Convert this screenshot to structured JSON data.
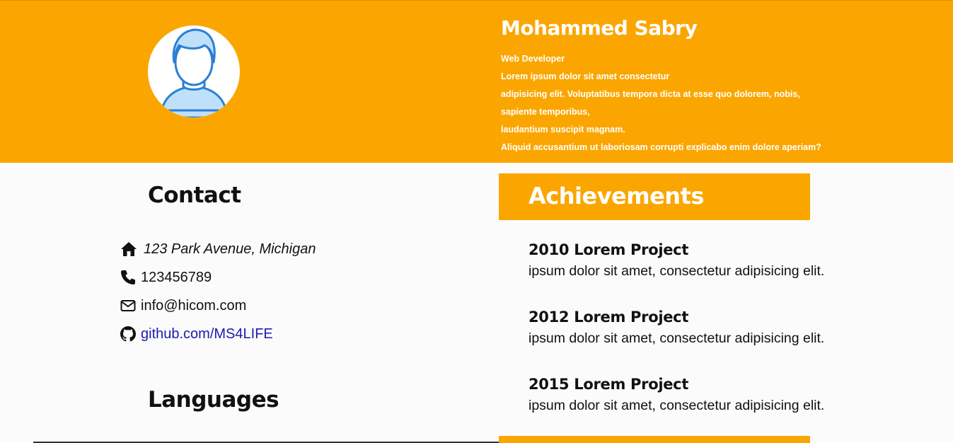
{
  "header": {
    "name": "Mohammed Sabry",
    "bio_lines": [
      "Web Developer",
      "Lorem ipsum dolor sit amet consectetur",
      "adipisicing elit. Voluptatibus tempora dicta at esse quo dolorem, nobis,",
      "sapiente temporibus,",
      "laudantium suscipit magnam.",
      "Aliquid accusantium ut laboriosam corrupti explicabo enim dolore aperiam?"
    ],
    "avatar_icon": "user-avatar-icon"
  },
  "contact": {
    "title": "Contact",
    "address": "123 Park Avenue, Michigan",
    "phone": "123456789",
    "email": "info@hicom.com",
    "github": "github.com/MS4LIFE",
    "icons": [
      "home-icon",
      "phone-icon",
      "envelope-icon",
      "github-icon"
    ]
  },
  "languages": {
    "title": "Languages"
  },
  "achievements": {
    "title": "Achievements",
    "items": [
      {
        "title": "2010 Lorem Project",
        "desc": "ipsum dolor sit amet, consectetur adipisicing elit."
      },
      {
        "title": "2012 Lorem Project",
        "desc": "ipsum dolor sit amet, consectetur adipisicing elit."
      },
      {
        "title": "2015 Lorem Project",
        "desc": "ipsum dolor sit amet, consectetur adipisicing elit."
      }
    ]
  },
  "colors": {
    "accent": "#fba600",
    "link": "#1b1bb0",
    "avatar_blue": "#2b7fd4"
  }
}
